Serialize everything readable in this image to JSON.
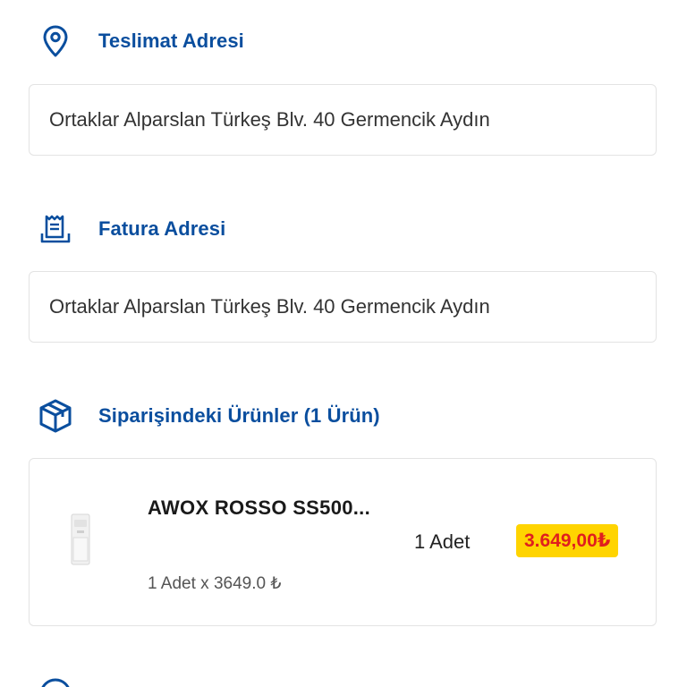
{
  "delivery": {
    "title": "Teslimat Adresi",
    "icon": "location-pin-icon",
    "address": "Ortaklar Alparslan Türkeş Blv. 40 Germencik Aydın"
  },
  "invoice": {
    "title": "Fatura Adresi",
    "icon": "receipt-icon",
    "address": "Ortaklar Alparslan Türkeş Blv. 40 Germencik Aydın"
  },
  "products": {
    "title": "Siparişindeki Ürünler (1 Ürün)",
    "icon": "package-box-icon",
    "items": [
      {
        "name": "AWOX ROSSO SS500...",
        "quantity": "1 Adet",
        "price": "3.649,00₺",
        "unit_line": "1 Adet x 3649.0 ₺"
      }
    ]
  },
  "colors": {
    "accent": "#0a4e9e",
    "price_bg": "#ffd400",
    "price_text": "#e01e1e",
    "border": "#e3e3e3"
  }
}
